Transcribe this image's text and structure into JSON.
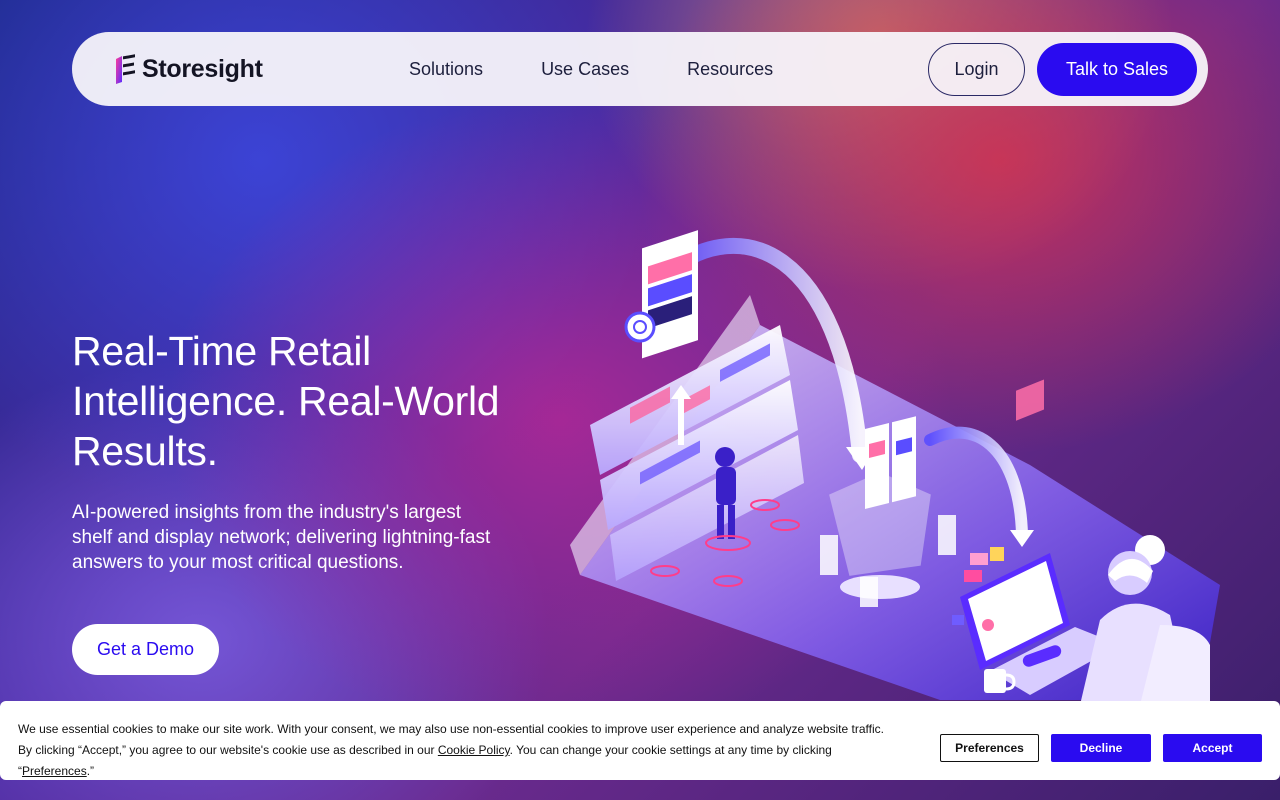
{
  "brand": {
    "name": "Storesight"
  },
  "nav": {
    "links": [
      "Solutions",
      "Use Cases",
      "Resources"
    ],
    "login_label": "Login",
    "sales_label": "Talk to Sales"
  },
  "hero": {
    "title_lines": [
      "Real-Time Retail",
      "Intelligence. Real-World",
      "Results."
    ],
    "subtitle": "AI-powered insights from the industry's largest shelf and display network; delivering lightning-fast answers to your most critical questions.",
    "cta_label": "Get a Demo"
  },
  "cookie_banner": {
    "text_part1": "We use essential cookies to make our site work. With your consent, we may also use non-essential cookies to improve user experience and analyze website traffic. By clicking “Accept,” you agree to our website's cookie use as described in our ",
    "cookie_policy_link": "Cookie Policy",
    "text_part2": ". You can change your cookie settings at any time by clicking “",
    "preferences_link": "Preferences",
    "text_part3": ".”",
    "preferences_button": "Preferences",
    "decline_button": "Decline",
    "accept_button": "Accept"
  },
  "colors": {
    "accent": "#2a0bf0",
    "nav_background": "#f7f4fa",
    "text_dark": "#1d1f3d"
  },
  "icons": {
    "logo": "storesight-logo-icon",
    "illustration": "retail-shelf-analytics-illustration"
  }
}
